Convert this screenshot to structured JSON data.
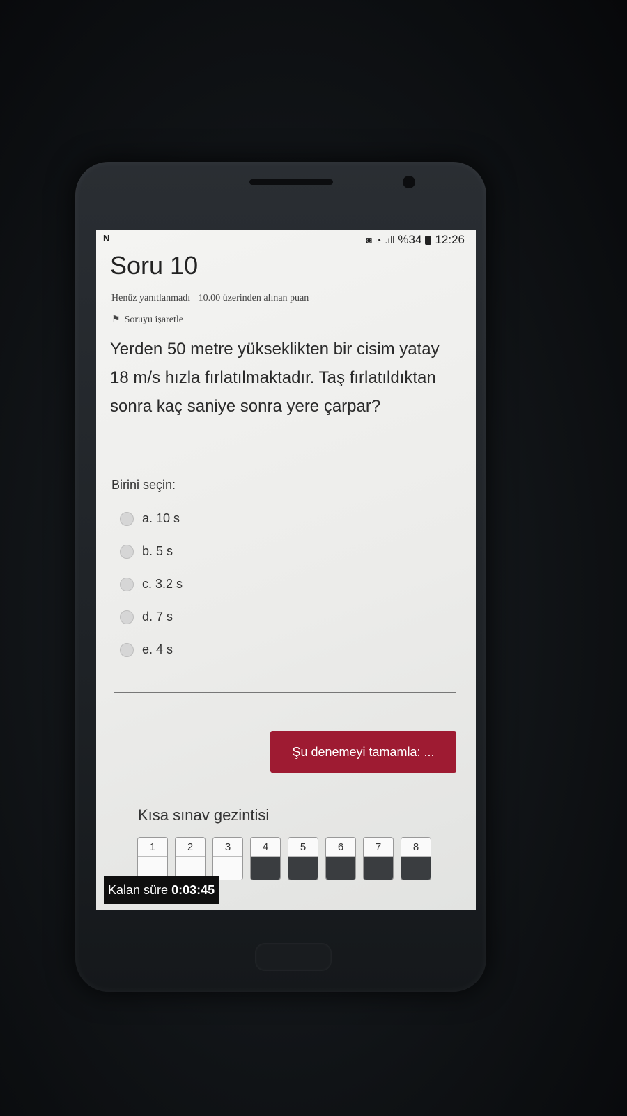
{
  "status_bar": {
    "left_icon": "N",
    "icons": [
      "alarm-icon",
      "wifi-icon",
      "signal-icon"
    ],
    "battery": "%34",
    "time": "12:26"
  },
  "question": {
    "title": "Soru 10",
    "state": "Henüz yanıtlanmadı",
    "points": "10.00 üzerinden alınan puan",
    "flag_label": "Soruyu işaretle",
    "text": "Yerden 50 metre yükseklikten bir cisim yatay 18 m/s hızla fırlatılmaktadır. Taş fırlatıldıktan sonra kaç saniye sonra yere çarpar?",
    "choose_label": "Birini seçin:",
    "options": [
      "a. 10 s",
      "b. 5 s",
      "c. 3.2 s",
      "d. 7 s",
      "e. 4 s"
    ]
  },
  "finish_button": "Şu denemeyi tamamla: ...",
  "navigation": {
    "title": "Kısa sınav gezintisi",
    "items": [
      "1",
      "2",
      "3",
      "4",
      "5",
      "6",
      "7",
      "8"
    ]
  },
  "timer": {
    "label": "Kalan süre",
    "value": "0:03:45"
  }
}
